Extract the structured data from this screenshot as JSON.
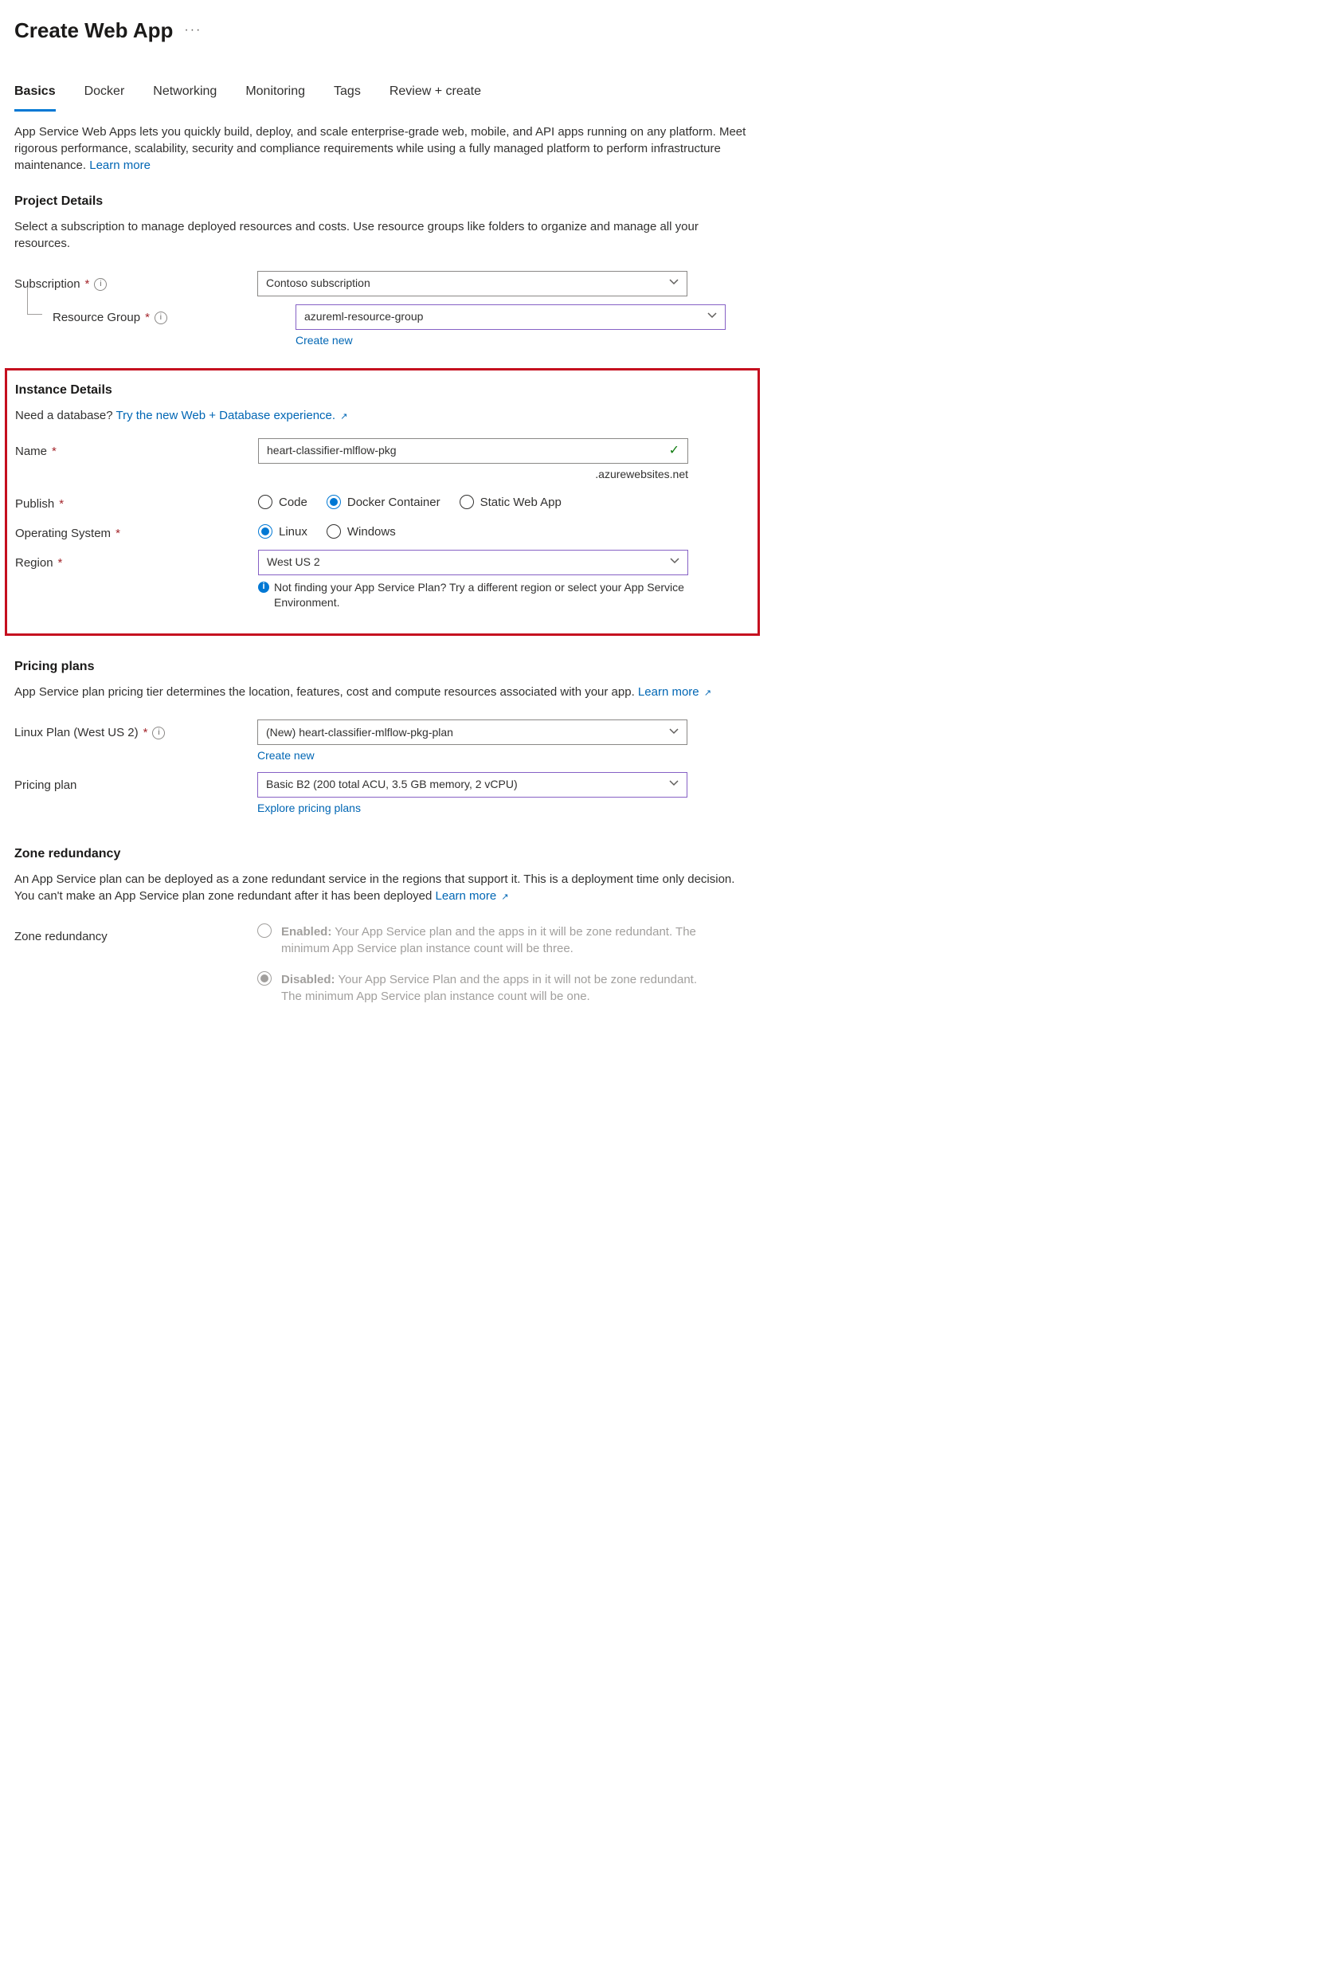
{
  "header": {
    "title": "Create Web App"
  },
  "tabs": {
    "items": [
      {
        "label": "Basics",
        "active": true
      },
      {
        "label": "Docker",
        "active": false
      },
      {
        "label": "Networking",
        "active": false
      },
      {
        "label": "Monitoring",
        "active": false
      },
      {
        "label": "Tags",
        "active": false
      },
      {
        "label": "Review + create",
        "active": false
      }
    ]
  },
  "intro": {
    "text": "App Service Web Apps lets you quickly build, deploy, and scale enterprise-grade web, mobile, and API apps running on any platform. Meet rigorous performance, scalability, security and compliance requirements while using a fully managed platform to perform infrastructure maintenance.  ",
    "learn_more": "Learn more"
  },
  "project_details": {
    "heading": "Project Details",
    "desc": "Select a subscription to manage deployed resources and costs. Use resource groups like folders to organize and manage all your resources.",
    "subscription_label": "Subscription",
    "subscription_value": "Contoso subscription",
    "resource_group_label": "Resource Group",
    "resource_group_value": "azureml-resource-group",
    "create_new": "Create new"
  },
  "instance": {
    "heading": "Instance Details",
    "db_prompt": "Need a database? ",
    "db_link": "Try the new Web + Database experience.",
    "name_label": "Name",
    "name_value": "heart-classifier-mlflow-pkg",
    "name_suffix": ".azurewebsites.net",
    "publish_label": "Publish",
    "publish_options": [
      {
        "label": "Code",
        "selected": false
      },
      {
        "label": "Docker Container",
        "selected": true
      },
      {
        "label": "Static Web App",
        "selected": false
      }
    ],
    "os_label": "Operating System",
    "os_options": [
      {
        "label": "Linux",
        "selected": true
      },
      {
        "label": "Windows",
        "selected": false
      }
    ],
    "region_label": "Region",
    "region_value": "West US 2",
    "region_hint": "Not finding your App Service Plan? Try a different region or select your App Service Environment."
  },
  "pricing": {
    "heading": "Pricing plans",
    "desc": "App Service plan pricing tier determines the location, features, cost and compute resources associated with your app. ",
    "learn_more": "Learn more",
    "plan_label": "Linux Plan (West US 2)",
    "plan_value": "(New) heart-classifier-mlflow-pkg-plan",
    "create_new": "Create new",
    "pricing_plan_label": "Pricing plan",
    "pricing_plan_value": "Basic B2 (200 total ACU, 3.5 GB memory, 2 vCPU)",
    "explore": "Explore pricing plans"
  },
  "zone": {
    "heading": "Zone redundancy",
    "desc": "An App Service plan can be deployed as a zone redundant service in the regions that support it. This is a deployment time only decision. You can't make an App Service plan zone redundant after it has been deployed ",
    "learn_more": "Learn more",
    "redundancy_label": "Zone redundancy",
    "enabled_title": "Enabled:",
    "enabled_desc": " Your App Service plan and the apps in it will be zone redundant. The minimum App Service plan instance count will be three.",
    "disabled_title": "Disabled:",
    "disabled_desc": " Your App Service Plan and the apps in it will not be zone redundant. The minimum App Service plan instance count will be one."
  }
}
